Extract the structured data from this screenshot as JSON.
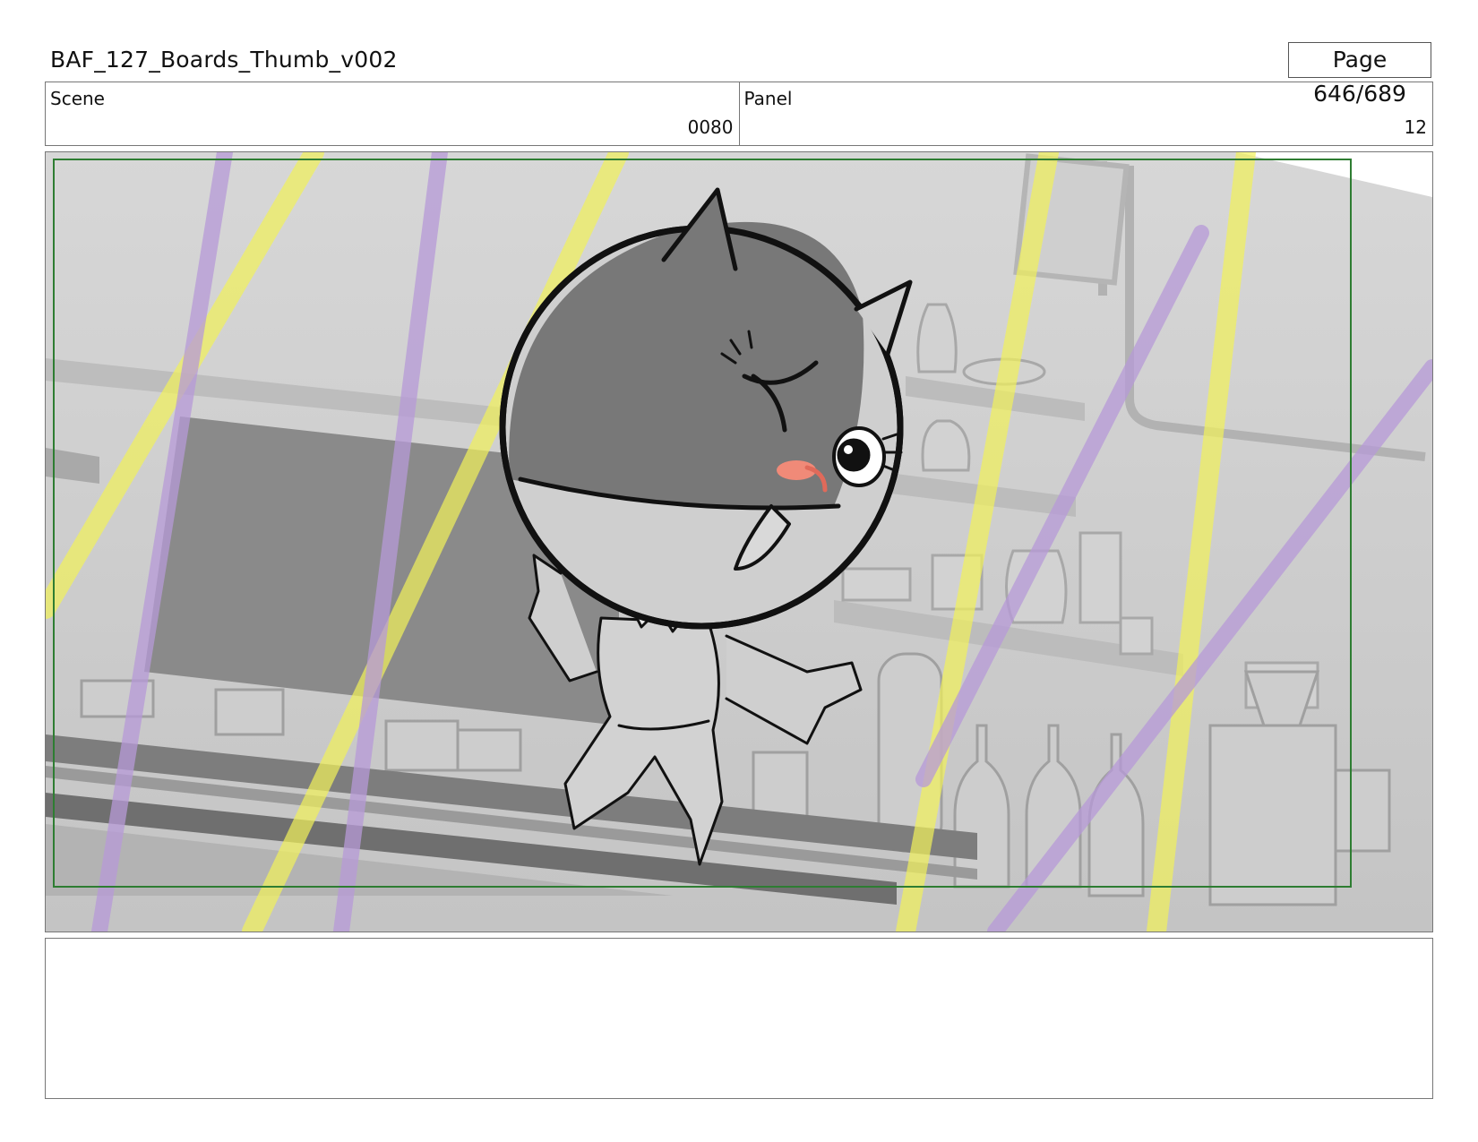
{
  "header": {
    "document_title": "BAF_127_Boards_Thumb_v002",
    "page_label": "Page 646/689"
  },
  "info": {
    "scene_label": "Scene",
    "scene_value": "0080",
    "panel_label": "Panel",
    "panel_value": "12"
  },
  "panel_image": {
    "description_name": "storyboard-drawing",
    "safe_frame_color": "#2e7d32",
    "light_beam_colors": [
      "#f2f25a",
      "#b79ad8"
    ]
  },
  "notes": {
    "text": ""
  }
}
